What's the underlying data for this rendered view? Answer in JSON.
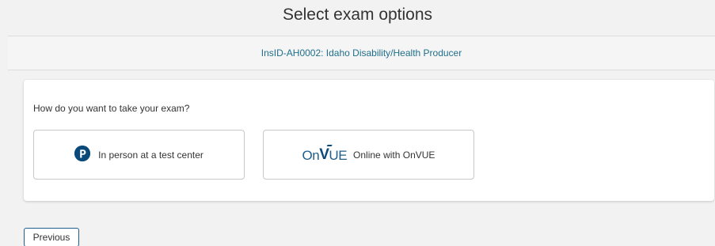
{
  "page": {
    "title": "Select exam options"
  },
  "exam": {
    "label": "InsID-AH0002: Idaho Disability/Health Producer"
  },
  "options": {
    "question": "How do you want to take your exam?",
    "in_person": {
      "icon": "pearson-logo-icon",
      "label": "In person at a test center"
    },
    "online": {
      "logo_text_on": "On",
      "logo_text_v": "V",
      "logo_text_ue": "UE",
      "label": "Online with OnVUE"
    }
  },
  "navigation": {
    "previous_label": "Previous"
  },
  "colors": {
    "accent": "#1f6f8b",
    "brand_dark": "#0a4a7a",
    "background": "#f2f2f2"
  }
}
